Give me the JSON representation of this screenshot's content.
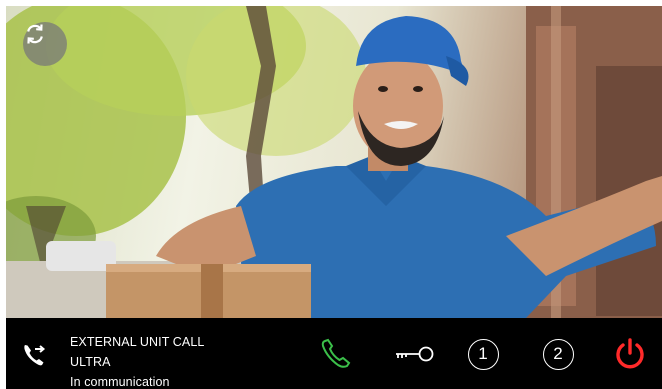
{
  "video": {
    "description_icon": "video-feed"
  },
  "controls": {
    "rotate_icon": "rotate-camera-icon",
    "answer_icon": "phone-answer-icon",
    "door_icon": "key-unlock-icon",
    "relay1_label": "1",
    "relay2_label": "2",
    "power_icon": "power-icon"
  },
  "call": {
    "status_icon": "incoming-call-icon",
    "title": "EXTERNAL UNIT CALL",
    "unit": "ULTRA",
    "state": "In communication"
  },
  "colors": {
    "answer": "#3bbf4a",
    "power": "#ff2a2a",
    "bar": "#000000"
  }
}
